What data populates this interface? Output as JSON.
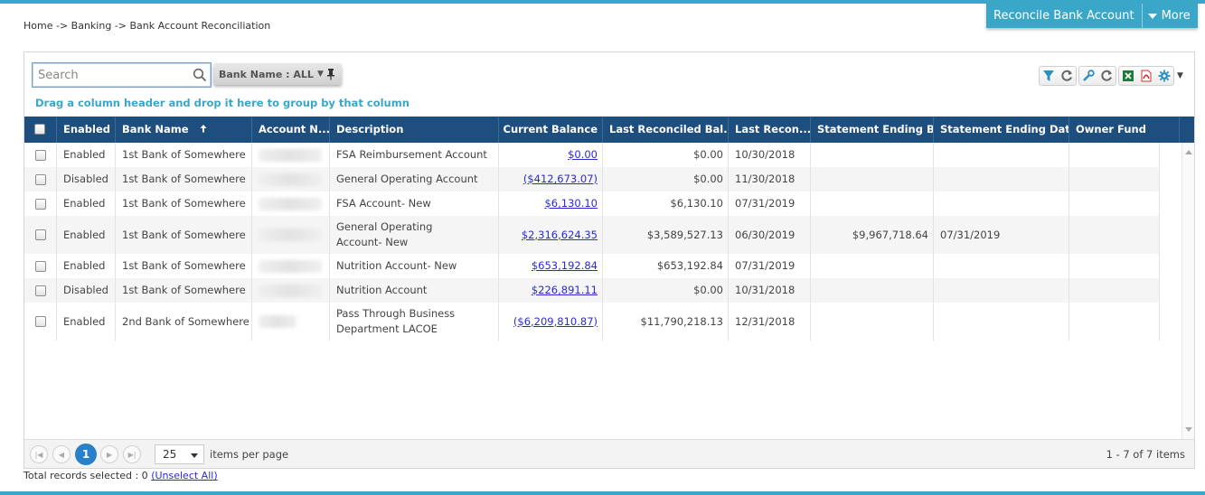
{
  "breadcrumb": [
    "Home",
    "->",
    "Banking",
    "->",
    "Bank Account Reconciliation"
  ],
  "actions": {
    "reconcile_label": "Reconcile Bank Account",
    "more_label": "More"
  },
  "search": {
    "placeholder": "Search",
    "value": ""
  },
  "bank_filter": {
    "label": "Bank Name : ALL"
  },
  "group_hint": "Drag a column header and drop it here to group by that column",
  "columns": {
    "enabled": "Enabled",
    "bank_name": "Bank Name",
    "account_number": "Account N...",
    "description": "Description",
    "current_balance": "Current Balance",
    "last_reconciled_balance": "Last Reconciled Bal...",
    "last_reconciled_date": "Last Recon...",
    "statement_ending_balance": "Statement Ending B...",
    "statement_ending_date": "Statement Ending Date",
    "owner_fund": "Owner Fund"
  },
  "rows": [
    {
      "enabled": "Enabled",
      "bank": "1st Bank of Somewhere",
      "description": "FSA Reimbursement Account",
      "current_balance": "$0.00",
      "last_reconciled_balance": "$0.00",
      "last_reconciled_date": "10/30/2018",
      "statement_ending_balance": "",
      "statement_ending_date": "",
      "owner_fund": ""
    },
    {
      "enabled": "Disabled",
      "bank": "1st Bank of Somewhere",
      "description": "General Operating Account",
      "current_balance": "($412,673.07)",
      "last_reconciled_balance": "$0.00",
      "last_reconciled_date": "11/30/2018",
      "statement_ending_balance": "",
      "statement_ending_date": "",
      "owner_fund": ""
    },
    {
      "enabled": "Enabled",
      "bank": "1st Bank of Somewhere",
      "description": "FSA Account- New",
      "current_balance": "$6,130.10",
      "last_reconciled_balance": "$6,130.10",
      "last_reconciled_date": "07/31/2019",
      "statement_ending_balance": "",
      "statement_ending_date": "",
      "owner_fund": ""
    },
    {
      "enabled": "Enabled",
      "bank": "1st Bank of Somewhere",
      "description": "General Operating Account- New",
      "current_balance": "$2,316,624.35",
      "last_reconciled_balance": "$3,589,527.13",
      "last_reconciled_date": "06/30/2019",
      "statement_ending_balance": "$9,967,718.64",
      "statement_ending_date": "07/31/2019",
      "owner_fund": ""
    },
    {
      "enabled": "Enabled",
      "bank": "1st Bank of Somewhere",
      "description": "Nutrition Account- New",
      "current_balance": "$653,192.84",
      "last_reconciled_balance": "$653,192.84",
      "last_reconciled_date": "07/31/2019",
      "statement_ending_balance": "",
      "statement_ending_date": "",
      "owner_fund": ""
    },
    {
      "enabled": "Disabled",
      "bank": "1st Bank of Somewhere",
      "description": "Nutrition Account",
      "current_balance": "$226,891.11",
      "last_reconciled_balance": "$0.00",
      "last_reconciled_date": "10/31/2018",
      "statement_ending_balance": "",
      "statement_ending_date": "",
      "owner_fund": ""
    },
    {
      "enabled": "Enabled",
      "bank": "2nd Bank of Somewhere",
      "description": "Pass Through Business Department LACOE",
      "current_balance": "($6,209,810.87)",
      "last_reconciled_balance": "$11,790,218.13",
      "last_reconciled_date": "12/31/2018",
      "statement_ending_balance": "",
      "statement_ending_date": "",
      "owner_fund": ""
    }
  ],
  "pager": {
    "current_page": "1",
    "page_size": "25",
    "per_page_label": "items per page",
    "info": "1 - 7 of 7 items"
  },
  "footer": {
    "selected_text": "Total records selected : 0",
    "unselect_label": "(Unselect All)"
  },
  "colors": {
    "accent": "#3aa7c9",
    "header_bg": "#1e4e7e",
    "link": "#2a2ad0",
    "page_active": "#2a7fc9"
  }
}
